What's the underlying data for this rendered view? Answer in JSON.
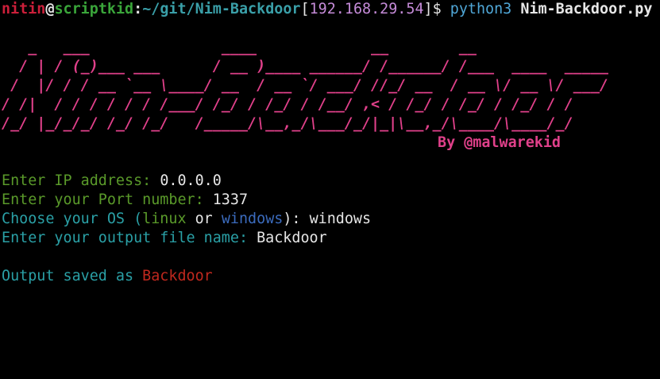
{
  "prompt": {
    "user": "nitin",
    "at": "@",
    "host": "scriptkid",
    "sep": ":",
    "path": "~/git/Nim-Backdoor",
    "bracket_open": "[",
    "ip": "192.168.29.54",
    "bracket_close": "]",
    "dollar": "$ ",
    "command": "python3",
    "argument": "Nim-Backdoor.py"
  },
  "banner": {
    "lines": [
      "   _   ___               ____             __        __",
      "  / | / (_)___ ___      / __ )____ ______/ /______/ /___  ____  _____",
      " /  |/ / / __ `__ \\____/ __  / __ `/ ___/ //_/ __  / __ \\/ __ \\/ ___/",
      "/ /|  / / / / / / /___/ /_/ / /_/ / /__/ ,< / /_/ / /_/ / /_/ / /",
      "/_/ |_/_/_/ /_/ /_/   /_____/\\__,_/\\___/_/|_|\\__,_/\\____/\\____/_/"
    ],
    "author": "By @malwarekid"
  },
  "inputs": {
    "ip_label": "Enter IP address: ",
    "ip_value": "0.0.0.0",
    "port_label": "Enter your Port number: ",
    "port_value": "1337",
    "os_label": "Choose your OS (",
    "os_opt1": "linux",
    "os_or": " or ",
    "os_opt2": "windows",
    "os_close": "): ",
    "os_value": "windows",
    "file_label": "Enter your output file name: ",
    "file_value": "Backdoor"
  },
  "result": {
    "label": "Output saved as ",
    "filename": "Backdoor"
  }
}
